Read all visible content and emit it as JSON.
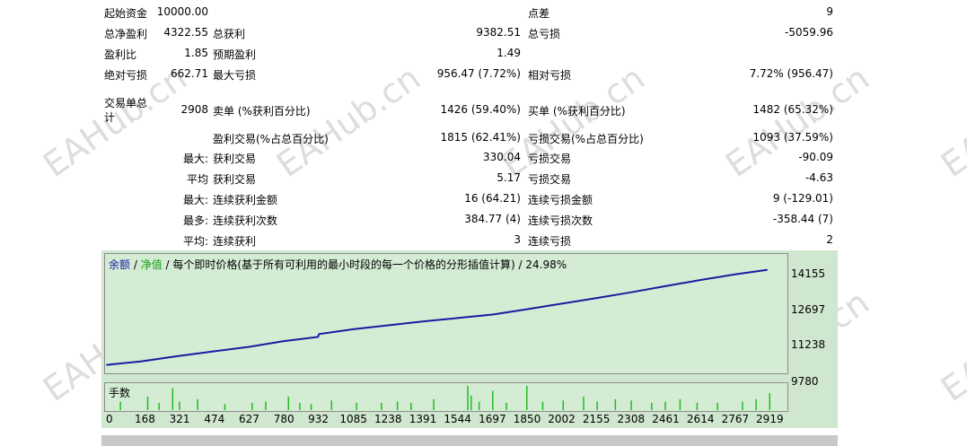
{
  "stats": {
    "initial_deposit_label": "起始资金",
    "initial_deposit_value": "10000.00",
    "spread_label": "点差",
    "spread_value": "9",
    "total_net_profit_label": "总净盈利",
    "total_net_profit_value": "4322.55",
    "gross_profit_label": "总获利",
    "gross_profit_value": "9382.51",
    "gross_loss_label": "总亏损",
    "gross_loss_value": "-5059.96",
    "profit_factor_label": "盈利比",
    "profit_factor_value": "1.85",
    "expected_payoff_label": "预期盈利",
    "expected_payoff_value": "1.49",
    "absolute_drawdown_label": "绝对亏损",
    "absolute_drawdown_value": "662.71",
    "maximal_drawdown_label": "最大亏损",
    "maximal_drawdown_value": "956.47 (7.72%)",
    "relative_drawdown_label": "相对亏损",
    "relative_drawdown_value": "7.72% (956.47)",
    "total_trades_label_1": "交易单总",
    "total_trades_label_2": "计",
    "total_trades_value": "2908",
    "short_label": "卖单 (%获利百分比)",
    "short_value": "1426 (59.40%)",
    "long_label": "买单 (%获利百分比)",
    "long_value": "1482 (65.32%)",
    "profit_trades_label": "盈利交易(%占总百分比)",
    "profit_trades_value": "1815 (62.41%)",
    "loss_trades_label": "亏损交易(%占总百分比)",
    "loss_trades_value": "1093 (37.59%)",
    "largest_prefix": "最大:",
    "largest_profit_label": "获利交易",
    "largest_profit_value": "330.04",
    "largest_loss_label": "亏损交易",
    "largest_loss_value": "-90.09",
    "average_prefix": "平均",
    "average_profit_label": "获利交易",
    "average_profit_value": "5.17",
    "average_loss_label": "亏损交易",
    "average_loss_value": "-4.63",
    "max_consec_prefix": "最大:",
    "max_consec_wins_label": "连续获利金额",
    "max_consec_wins_value": "16 (64.21)",
    "max_consec_losses_label": "连续亏损金额",
    "max_consec_losses_value": "9 (-129.01)",
    "maximal_prefix": "最多:",
    "maximal_consec_profit_label": "连续获利次数",
    "maximal_consec_profit_value": "384.77 (4)",
    "maximal_consec_loss_label": "连续亏损次数",
    "maximal_consec_loss_value": "-358.44 (7)",
    "avg_consec_prefix": "平均:",
    "avg_consec_wins_label": "连续获利",
    "avg_consec_wins_value": "3",
    "avg_consec_losses_label": "连续亏损",
    "avg_consec_losses_value": "2"
  },
  "watermark": "EAHub.cn",
  "colors": {
    "balance": "#1a1aa0",
    "equity": "#11a011",
    "lots": "#22bb22",
    "panel": "#cfe6cf"
  },
  "chart_data": {
    "type": "line",
    "legend": {
      "balance": "余额",
      "sep1": " / ",
      "equity": "净值",
      "sep2": " / ",
      "text": "每个即时价格(基于所有可利用的最小时段的每一个价格的分形插值计算) / 24.98%"
    },
    "y_ticks": [
      "14155",
      "12697",
      "11238",
      "9780"
    ],
    "ylim": [
      9780,
      14880
    ],
    "x_ticks": [
      "0",
      "168",
      "321",
      "474",
      "627",
      "780",
      "932",
      "1085",
      "1238",
      "1391",
      "1544",
      "1697",
      "1850",
      "2002",
      "2155",
      "2308",
      "2461",
      "2614",
      "2767",
      "2919"
    ],
    "xlim": [
      0,
      2990
    ],
    "series": [
      {
        "name": "余额",
        "x": [
          0,
          150,
          300,
          460,
          627,
          780,
          930,
          935,
          1085,
          1240,
          1390,
          1545,
          1700,
          1850,
          2000,
          2155,
          2310,
          2460,
          2615,
          2770,
          2908
        ],
        "values": [
          10000,
          10160,
          10380,
          10600,
          10820,
          11080,
          11270,
          11400,
          11620,
          11800,
          11970,
          12130,
          12290,
          12530,
          12780,
          13030,
          13300,
          13580,
          13860,
          14120,
          14322
        ]
      }
    ],
    "lots_label": "手数",
    "lots_spikes": [
      {
        "x": 60,
        "h": 0.35
      },
      {
        "x": 180,
        "h": 0.55
      },
      {
        "x": 230,
        "h": 0.3
      },
      {
        "x": 290,
        "h": 0.9
      },
      {
        "x": 320,
        "h": 0.35
      },
      {
        "x": 400,
        "h": 0.45
      },
      {
        "x": 520,
        "h": 0.25
      },
      {
        "x": 640,
        "h": 0.3
      },
      {
        "x": 700,
        "h": 0.35
      },
      {
        "x": 800,
        "h": 0.55
      },
      {
        "x": 850,
        "h": 0.3
      },
      {
        "x": 900,
        "h": 0.25
      },
      {
        "x": 990,
        "h": 0.4
      },
      {
        "x": 1100,
        "h": 0.3
      },
      {
        "x": 1210,
        "h": 0.3
      },
      {
        "x": 1280,
        "h": 0.35
      },
      {
        "x": 1340,
        "h": 0.3
      },
      {
        "x": 1440,
        "h": 0.45
      },
      {
        "x": 1590,
        "h": 1.0
      },
      {
        "x": 1605,
        "h": 0.6
      },
      {
        "x": 1640,
        "h": 0.35
      },
      {
        "x": 1700,
        "h": 0.8
      },
      {
        "x": 1760,
        "h": 0.3
      },
      {
        "x": 1850,
        "h": 1.0
      },
      {
        "x": 1920,
        "h": 0.35
      },
      {
        "x": 2010,
        "h": 0.4
      },
      {
        "x": 2100,
        "h": 0.55
      },
      {
        "x": 2160,
        "h": 0.35
      },
      {
        "x": 2240,
        "h": 0.45
      },
      {
        "x": 2310,
        "h": 0.4
      },
      {
        "x": 2400,
        "h": 0.3
      },
      {
        "x": 2460,
        "h": 0.35
      },
      {
        "x": 2525,
        "h": 0.45
      },
      {
        "x": 2600,
        "h": 0.3
      },
      {
        "x": 2690,
        "h": 0.3
      },
      {
        "x": 2800,
        "h": 0.35
      },
      {
        "x": 2860,
        "h": 0.45
      },
      {
        "x": 2920,
        "h": 0.7
      }
    ]
  }
}
